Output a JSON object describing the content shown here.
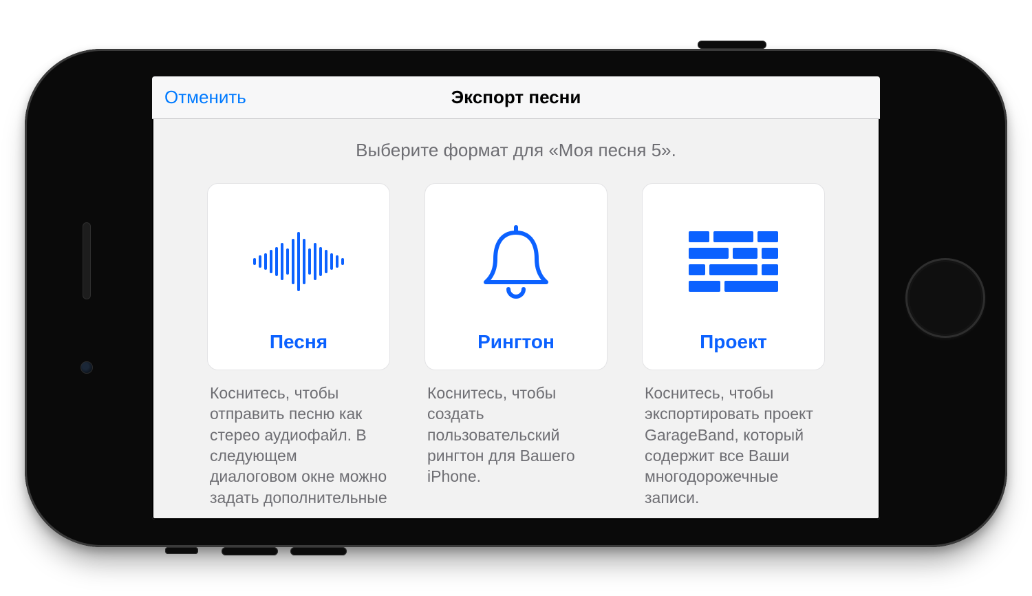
{
  "nav": {
    "cancel": "Отменить",
    "title": "Экспорт песни"
  },
  "subtitle": "Выберите формат для «Моя песня 5».",
  "options": [
    {
      "label": "Песня",
      "desc": "Коснитесь, чтобы отправить песню как стерео аудиофайл. В следующем диалоговом окне можно задать дополнительные"
    },
    {
      "label": "Рингтон",
      "desc": "Коснитесь, чтобы создать пользовательский рингтон для Вашего iPhone."
    },
    {
      "label": "Проект",
      "desc": "Коснитесь, чтобы экспортировать проект GarageBand, который содержит все Ваши многодорожечные записи."
    }
  ]
}
